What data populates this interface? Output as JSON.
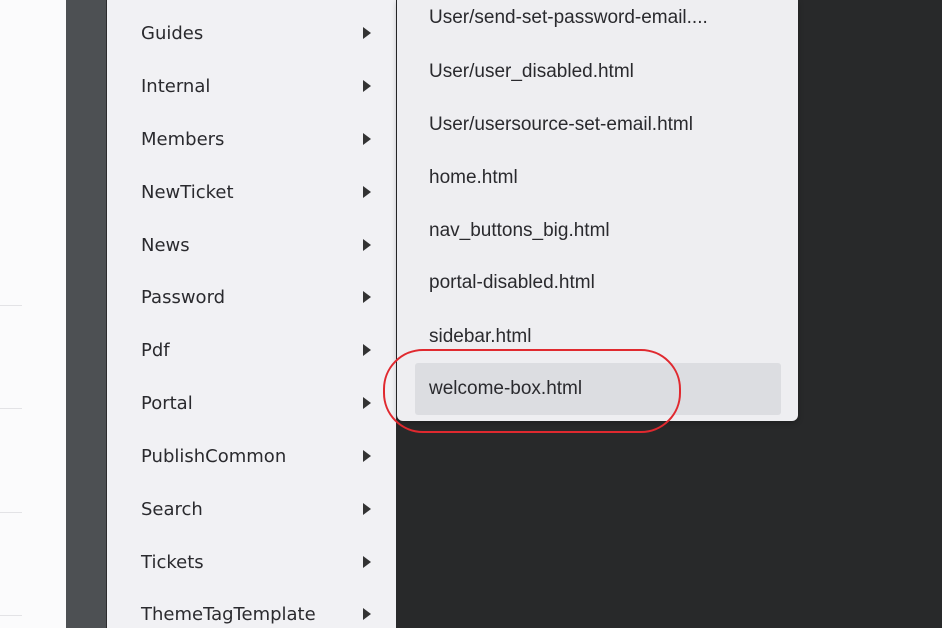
{
  "main_menu": {
    "items": [
      {
        "label": "Guides"
      },
      {
        "label": "Internal"
      },
      {
        "label": "Members"
      },
      {
        "label": "NewTicket"
      },
      {
        "label": "News"
      },
      {
        "label": "Password"
      },
      {
        "label": "Pdf"
      },
      {
        "label": "Portal"
      },
      {
        "label": "PublishCommon"
      },
      {
        "label": "Search"
      },
      {
        "label": "Tickets"
      },
      {
        "label": "ThemeTagTemplate"
      }
    ]
  },
  "submenu": {
    "items": [
      {
        "label": "User/send-set-password-email...."
      },
      {
        "label": "User/user_disabled.html"
      },
      {
        "label": "User/usersource-set-email.html"
      },
      {
        "label": "home.html"
      },
      {
        "label": "nav_buttons_big.html"
      },
      {
        "label": "portal-disabled.html"
      },
      {
        "label": "sidebar.html"
      },
      {
        "label": "welcome-box.html",
        "highlighted": true
      }
    ]
  },
  "colors": {
    "callout": "#e0292f",
    "editor_background": "#28292a",
    "menu_background": "#f1f1f4",
    "highlight": "#dcdde1"
  },
  "icons": {
    "submenu_arrow": "triangle-right-icon"
  }
}
